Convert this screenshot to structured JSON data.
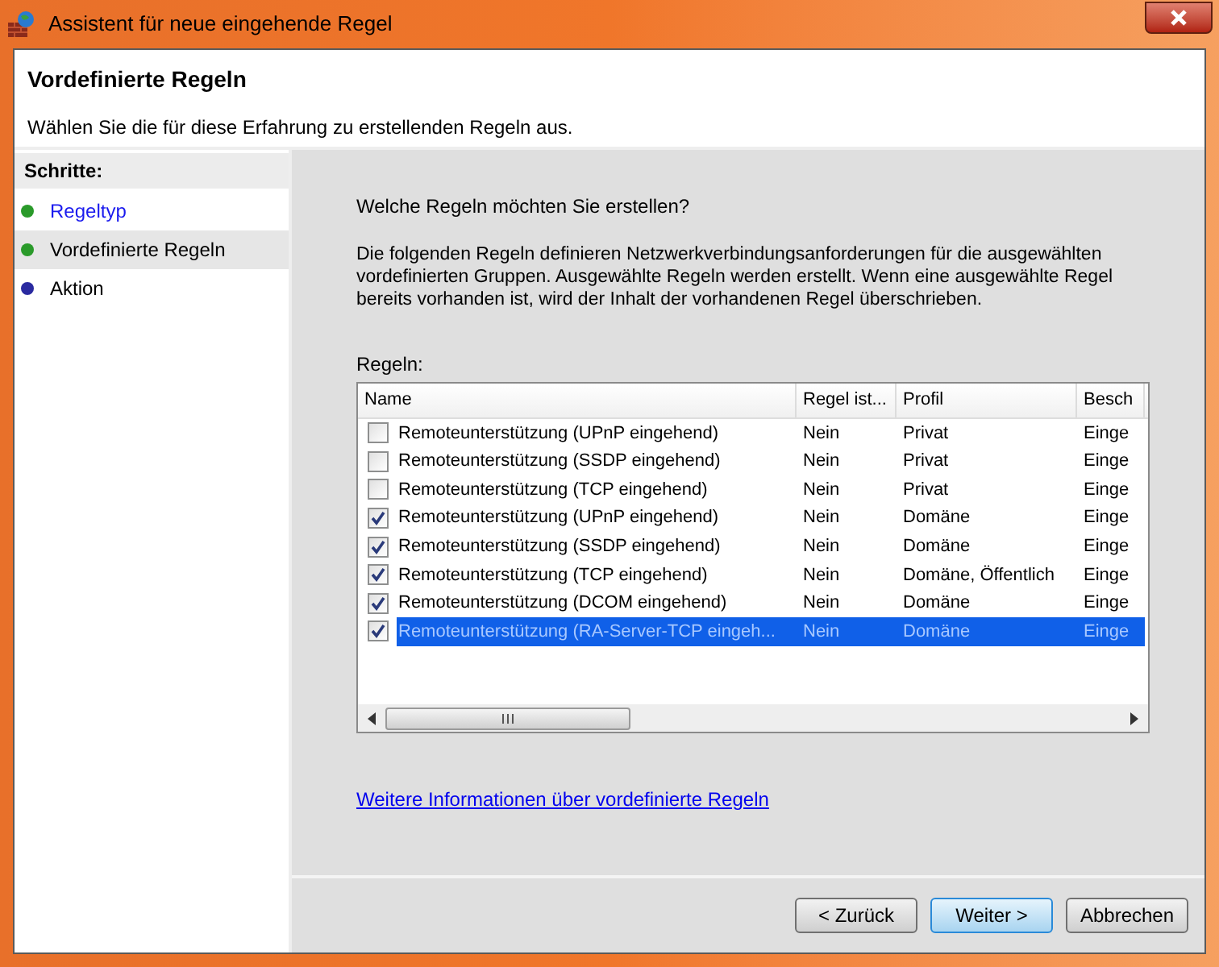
{
  "window": {
    "title": "Assistent für neue eingehende Regel"
  },
  "header": {
    "title": "Vordefinierte Regeln",
    "subtitle": "Wählen Sie die für diese Erfahrung zu erstellenden Regeln aus."
  },
  "steps": {
    "heading": "Schritte:",
    "items": [
      {
        "label": "Regeltyp",
        "kind": "link",
        "selected": false,
        "color": "#2a9a2a"
      },
      {
        "label": "Vordefinierte Regeln",
        "kind": "plain",
        "selected": true,
        "color": "#2a9a2a"
      },
      {
        "label": "Aktion",
        "kind": "plain",
        "selected": false,
        "color": "#2a2aa0"
      }
    ]
  },
  "question": "Welche Regeln möchten Sie erstellen?",
  "description": "Die folgenden Regeln definieren Netzwerkverbindungsanforderungen für die ausgewählten vordefinierten Gruppen. Ausgewählte Regeln werden erstellt. Wenn eine ausgewählte Regel bereits vorhanden ist, wird der Inhalt der vorhandenen Regel überschrieben.",
  "table": {
    "label": "Regeln:",
    "columns": [
      "Name",
      "Regel ist...",
      "Profil",
      "Besch"
    ],
    "rows": [
      {
        "checked": false,
        "selected": false,
        "cells": [
          "Remoteunterstützung (UPnP eingehend)",
          "Nein",
          "Privat",
          "Einge"
        ]
      },
      {
        "checked": false,
        "selected": false,
        "cells": [
          "Remoteunterstützung (SSDP eingehend)",
          "Nein",
          "Privat",
          "Einge"
        ]
      },
      {
        "checked": false,
        "selected": false,
        "cells": [
          "Remoteunterstützung (TCP eingehend)",
          "Nein",
          "Privat",
          "Einge"
        ]
      },
      {
        "checked": true,
        "selected": false,
        "cells": [
          "Remoteunterstützung (UPnP eingehend)",
          "Nein",
          "Domäne",
          "Einge"
        ]
      },
      {
        "checked": true,
        "selected": false,
        "cells": [
          "Remoteunterstützung (SSDP eingehend)",
          "Nein",
          "Domäne",
          "Einge"
        ]
      },
      {
        "checked": true,
        "selected": false,
        "cells": [
          "Remoteunterstützung (TCP eingehend)",
          "Nein",
          "Domäne, Öffentlich",
          "Einge"
        ]
      },
      {
        "checked": true,
        "selected": false,
        "cells": [
          "Remoteunterstützung (DCOM eingehend)",
          "Nein",
          "Domäne",
          "Einge"
        ]
      },
      {
        "checked": true,
        "selected": true,
        "cells": [
          "Remoteunterstützung (RA-Server-TCP eingeh...",
          "Nein",
          "Domäne",
          "Einge"
        ]
      }
    ]
  },
  "link": "Weitere Informationen über vordefinierte Regeln",
  "buttons": [
    {
      "label": "< Zurück",
      "default": false
    },
    {
      "label": "Weiter >",
      "default": true
    },
    {
      "label": "Abbrechen",
      "default": false
    }
  ]
}
